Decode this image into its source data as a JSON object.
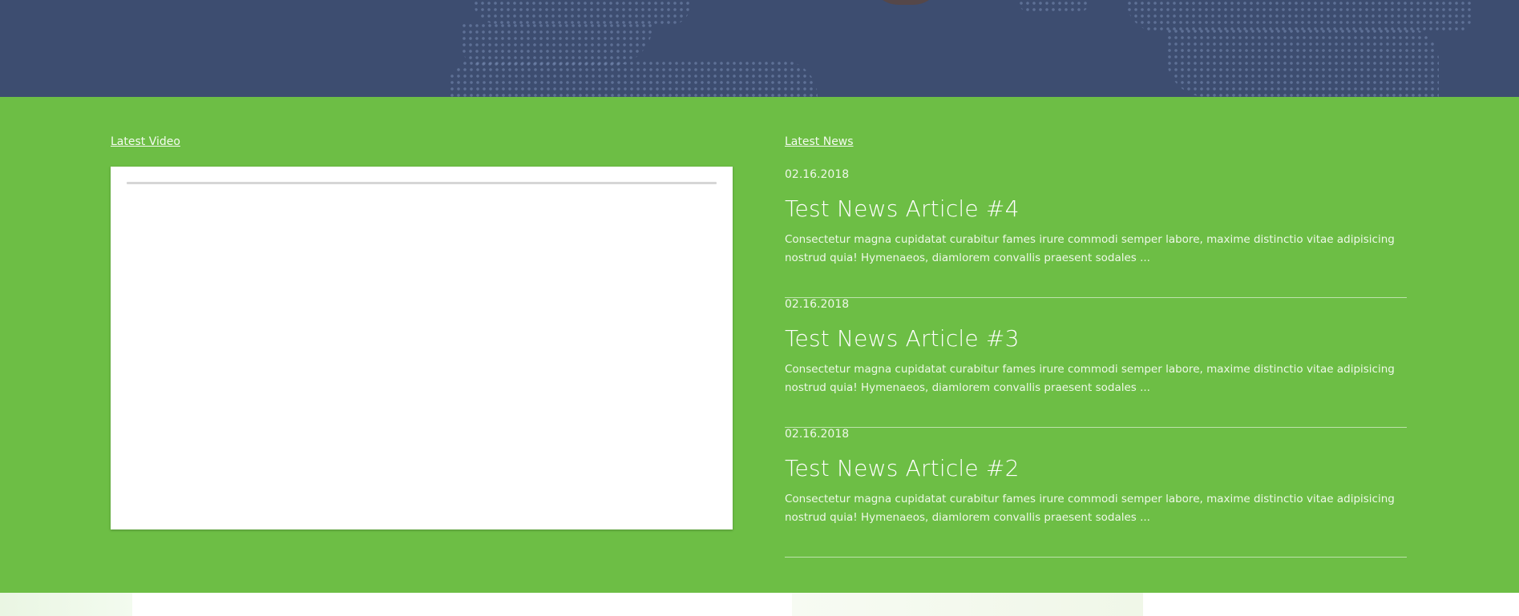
{
  "sections": {
    "video_link": "Latest Video",
    "news_link": "Latest News"
  },
  "news": [
    {
      "date": "02.16.2018",
      "title": "Test News Article #4",
      "excerpt": "Consectetur magna cupidatat curabitur fames irure commodi semper labore, maxime distinctio vitae adipisicing nostrud quia! Hymenaeos, diamlorem convallis praesent sodales ..."
    },
    {
      "date": "02.16.2018",
      "title": "Test News Article #3",
      "excerpt": "Consectetur magna cupidatat curabitur fames irure commodi semper labore, maxime distinctio vitae adipisicing nostrud quia! Hymenaeos, diamlorem convallis praesent sodales ..."
    },
    {
      "date": "02.16.2018",
      "title": "Test News Article #2",
      "excerpt": "Consectetur magna cupidatat curabitur fames irure commodi semper labore, maxime distinctio vitae adipisicing nostrud quia! Hymenaeos, diamlorem convallis praesent sodales ..."
    }
  ],
  "colors": {
    "hero_bg": "#3d4d70",
    "main_bg": "#6dbe45",
    "panel_bg": "#ffffff"
  }
}
